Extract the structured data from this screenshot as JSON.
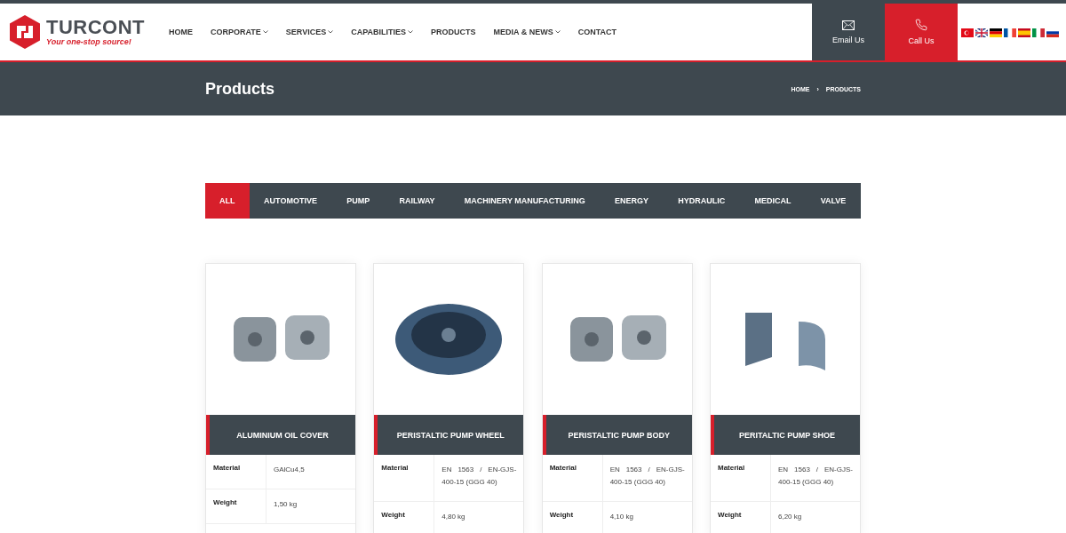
{
  "logo": {
    "name": "TURCONT",
    "tagline": "Your one-stop source!"
  },
  "nav": [
    {
      "label": "HOME",
      "has_dropdown": false
    },
    {
      "label": "CORPORATE",
      "has_dropdown": true
    },
    {
      "label": "SERVICES",
      "has_dropdown": true
    },
    {
      "label": "CAPABILITIES",
      "has_dropdown": true
    },
    {
      "label": "PRODUCTS",
      "has_dropdown": false
    },
    {
      "label": "MEDIA & NEWS",
      "has_dropdown": true
    },
    {
      "label": "CONTACT",
      "has_dropdown": false
    }
  ],
  "contact_buttons": [
    {
      "kind": "email",
      "label": "Email Us"
    },
    {
      "kind": "phone",
      "label": "Call Us"
    }
  ],
  "languages": [
    {
      "kind": "tr"
    },
    {
      "kind": "gb"
    },
    {
      "kind": "de"
    },
    {
      "kind": "fr"
    },
    {
      "kind": "es"
    },
    {
      "kind": "it"
    },
    {
      "kind": "ru"
    }
  ],
  "page_title": "Products",
  "breadcrumbs": [
    "HOME",
    "PRODUCTS"
  ],
  "breadcrumb_separator": "›",
  "filters": [
    {
      "label": "ALL",
      "selected": true
    },
    {
      "label": "AUTOMOTIVE",
      "selected": false
    },
    {
      "label": "PUMP",
      "selected": false
    },
    {
      "label": "RAILWAY",
      "selected": false
    },
    {
      "label": "MACHINERY MANUFACTURING",
      "selected": false
    },
    {
      "label": "ENERGY",
      "selected": false
    },
    {
      "label": "HYDRAULIC",
      "selected": false
    },
    {
      "label": "MEDICAL",
      "selected": false
    },
    {
      "label": "VALVE",
      "selected": false
    }
  ],
  "products": [
    {
      "name": "ALUMINIUM OIL COVER",
      "specs": [
        {
          "label": "Material",
          "value": "GAlCu4,5"
        },
        {
          "label": "Weight",
          "value": "1,50 kg"
        }
      ]
    },
    {
      "name": "PERISTALTIC PUMP WHEEL",
      "specs": [
        {
          "label": "Material",
          "value": "EN 1563 / EN-GJS-400-15 (GGG 40)"
        },
        {
          "label": "Weight",
          "value": "4,80 kg"
        }
      ]
    },
    {
      "name": "PERISTALTIC PUMP BODY",
      "specs": [
        {
          "label": "Material",
          "value": "EN 1563 / EN-GJS-400-15 (GGG 40)"
        },
        {
          "label": "Weight",
          "value": "4,10 kg"
        }
      ]
    },
    {
      "name": "PERITALTIC PUMP SHOE",
      "specs": [
        {
          "label": "Material",
          "value": "EN 1563 / EN-GJS-400-15 (GGG 40)"
        },
        {
          "label": "Weight",
          "value": "6,20 kg"
        }
      ]
    }
  ]
}
